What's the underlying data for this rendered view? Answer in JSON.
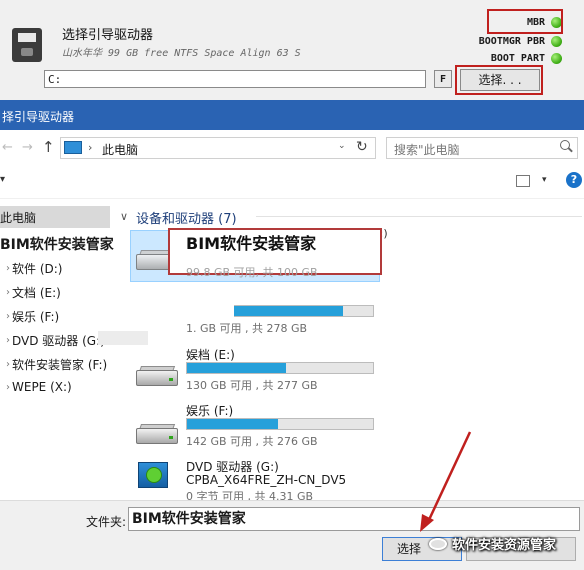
{
  "top_panel": {
    "title": "选择引导驱动器",
    "subtitle": "山水年华 99 GB free NTFS Space Align 63 S",
    "drive_value": "C:",
    "f_button": "F",
    "select_button": "选择. . .",
    "status": [
      {
        "label": "MBR",
        "state": "ok"
      },
      {
        "label": "BOOTMGR PBR",
        "state": "ok"
      },
      {
        "label": "BOOT PART",
        "state": "ok"
      }
    ],
    "status_color": "#3fae16",
    "highlight_color": "#c0201e"
  },
  "dialog": {
    "title": "择引导驱动器",
    "titlebar_color": "#2a63b3"
  },
  "address": {
    "back": "←",
    "forward": "→",
    "up": "↑",
    "path": "此电脑",
    "separator": "›",
    "dropdown": "⌄",
    "refresh": "↻",
    "search_placeholder": "搜索\"此电脑"
  },
  "toolbar": {
    "organize_caret": "▾",
    "view_caret": "▾",
    "help": "?"
  },
  "nav": {
    "items": [
      {
        "label": "此电脑",
        "chevron": ""
      },
      {
        "label": "BIM软件安装管家",
        "chevron": ""
      },
      {
        "label": "软件 (D:)",
        "chevron": "›"
      },
      {
        "label": "文档 (E:)",
        "chevron": "›"
      },
      {
        "label": "娱乐 (F:)",
        "chevron": "›"
      },
      {
        "label": "DVD 驱动器 (G:) C",
        "chevron": "›"
      },
      {
        "label": "软件安装管家 (F:)",
        "chevron": "›"
      },
      {
        "label": "WEPE (X:)",
        "chevron": "›"
      }
    ]
  },
  "content": {
    "group_chevron": "∨",
    "group_title": "设备和驱动器 (7)",
    "drives": [
      {
        "name": "BIM软件安装管家",
        "name_tail": "C:)",
        "info": "99.8 GB 可用, 共 100 GB",
        "used_fraction": null
      },
      {
        "name": "",
        "info": "1. GB 可用 , 共 278 GB",
        "used_fraction": 0.84
      },
      {
        "name": "娱档 (E:)",
        "info": "130 GB 可用 , 共 277 GB",
        "used_fraction": 0.53
      },
      {
        "name": "娱乐 (F:)",
        "info": "142 GB 可用 , 共 276 GB",
        "used_fraction": 0.49
      },
      {
        "name": "DVD 驱动器 (G:)",
        "label": "CPBA_X64FRE_ZH-CN_DV5",
        "info": "0 字节 可用 , 共 4.31 GB",
        "used_fraction": null
      }
    ],
    "bar_color": "#26a0da"
  },
  "bottom": {
    "folder_label": "文件夹:",
    "folder_value": "BIM软件安装管家",
    "select_button": "选择"
  },
  "watermark": {
    "text": "软件安装资源管家"
  },
  "annotation_color": "#c0201e"
}
